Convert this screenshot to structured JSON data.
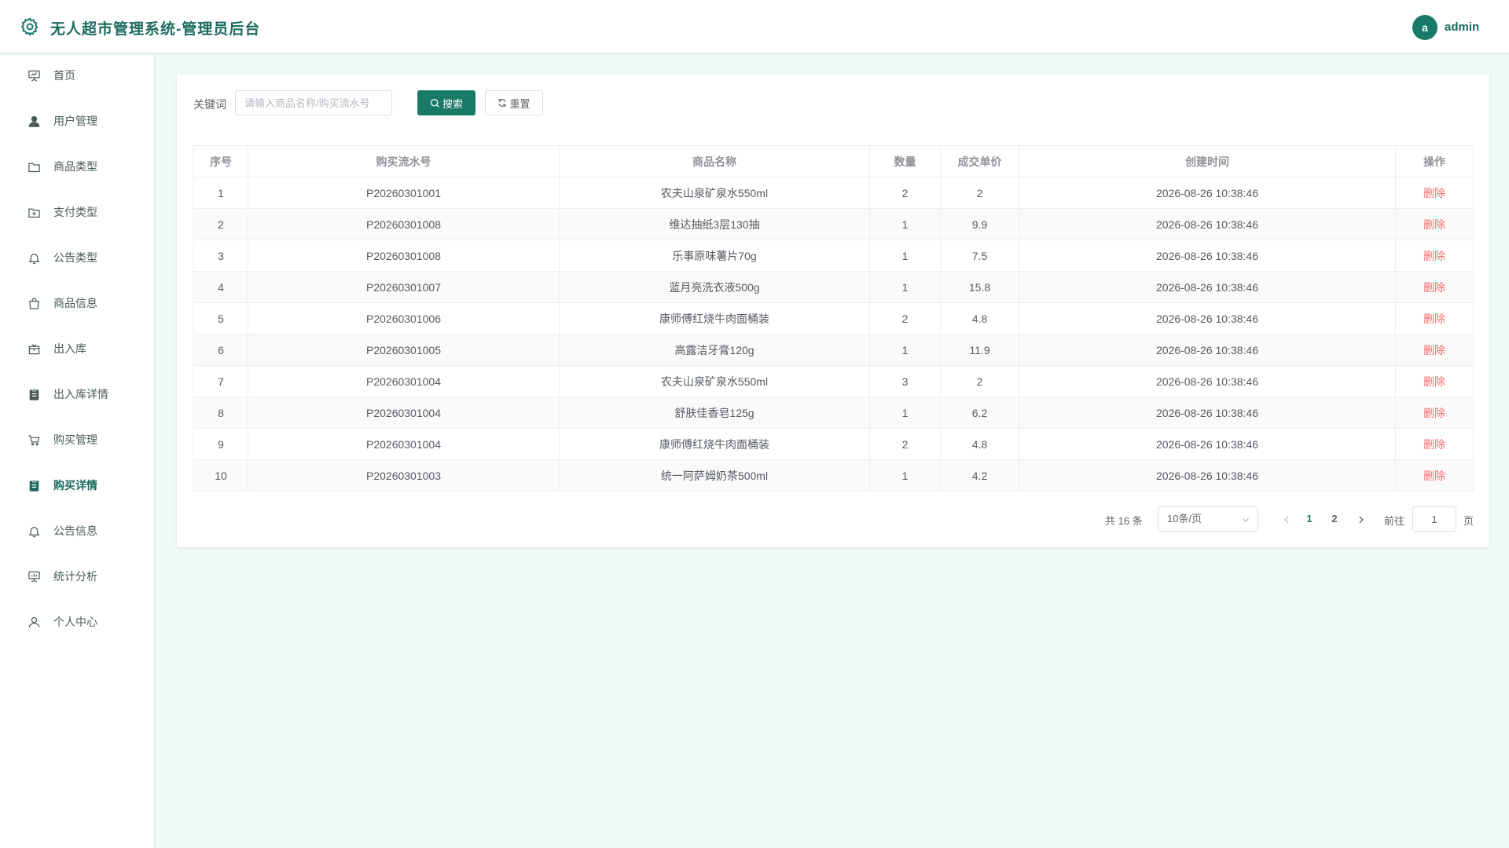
{
  "header": {
    "title": "无人超市管理系统-管理员后台",
    "logo_icon": "gear-icon",
    "avatar_letter": "a",
    "username": "admin",
    "accent_color": "#1a7a68"
  },
  "sidebar": {
    "items": [
      {
        "label": "首页",
        "icon": "presentation-icon",
        "active": false
      },
      {
        "label": "用户管理",
        "icon": "user-filled-icon",
        "active": false
      },
      {
        "label": "商品类型",
        "icon": "folder-icon",
        "active": false
      },
      {
        "label": "支付类型",
        "icon": "folder-add-icon",
        "active": false
      },
      {
        "label": "公告类型",
        "icon": "bell-icon",
        "active": false
      },
      {
        "label": "商品信息",
        "icon": "shopping-bag-icon",
        "active": false
      },
      {
        "label": "出入库",
        "icon": "box-icon",
        "active": false
      },
      {
        "label": "出入库详情",
        "icon": "clipboard-icon",
        "active": false
      },
      {
        "label": "购买管理",
        "icon": "cart-icon",
        "active": false
      },
      {
        "label": "购买详情",
        "icon": "document-icon",
        "active": true
      },
      {
        "label": "公告信息",
        "icon": "bell-icon",
        "active": false
      },
      {
        "label": "统计分析",
        "icon": "chart-board-icon",
        "active": false
      },
      {
        "label": "个人中心",
        "icon": "user-icon",
        "active": false
      }
    ]
  },
  "search": {
    "label": "关键词",
    "placeholder": "请输入商品名称/购买流水号",
    "value": "",
    "search_button": "搜索",
    "reset_button": "重置"
  },
  "table": {
    "columns": [
      "序号",
      "购买流水号",
      "商品名称",
      "数量",
      "成交单价",
      "创建时间",
      "操作"
    ],
    "rows": [
      [
        "1",
        "P20260301001",
        "农夫山泉矿泉水550ml",
        "2",
        "2",
        "2026-08-26 10:38:46",
        "删除"
      ],
      [
        "2",
        "P20260301008",
        "维达抽纸3层130抽",
        "1",
        "9.9",
        "2026-08-26 10:38:46",
        "删除"
      ],
      [
        "3",
        "P20260301008",
        "乐事原味薯片70g",
        "1",
        "7.5",
        "2026-08-26 10:38:46",
        "删除"
      ],
      [
        "4",
        "P20260301007",
        "蓝月亮洗衣液500g",
        "1",
        "15.8",
        "2026-08-26 10:38:46",
        "删除"
      ],
      [
        "5",
        "P20260301006",
        "康师傅红烧牛肉面桶装",
        "2",
        "4.8",
        "2026-08-26 10:38:46",
        "删除"
      ],
      [
        "6",
        "P20260301005",
        "高露洁牙膏120g",
        "1",
        "11.9",
        "2026-08-26 10:38:46",
        "删除"
      ],
      [
        "7",
        "P20260301004",
        "农夫山泉矿泉水550ml",
        "3",
        "2",
        "2026-08-26 10:38:46",
        "删除"
      ],
      [
        "8",
        "P20260301004",
        "舒肤佳香皂125g",
        "1",
        "6.2",
        "2026-08-26 10:38:46",
        "删除"
      ],
      [
        "9",
        "P20260301004",
        "康师傅红烧牛肉面桶装",
        "2",
        "4.8",
        "2026-08-26 10:38:46",
        "删除"
      ],
      [
        "10",
        "P20260301003",
        "统一阿萨姆奶茶500ml",
        "1",
        "4.2",
        "2026-08-26 10:38:46",
        "删除"
      ]
    ]
  },
  "pagination": {
    "total_text": "共 16 条",
    "page_size": "10条/页",
    "pages": [
      "1",
      "2"
    ],
    "current_page": "1",
    "goto_label": "前往",
    "goto_value": "1",
    "page_suffix": "页"
  }
}
